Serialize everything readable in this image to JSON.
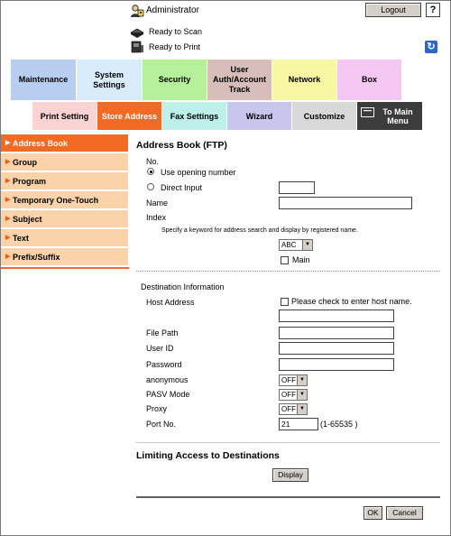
{
  "header": {
    "user": "Administrator",
    "logout_label": "Logout",
    "help_label": "?",
    "status_scan": "Ready to Scan",
    "status_print": "Ready to Print"
  },
  "top_tabs": [
    {
      "label": "Maintenance",
      "color": "#b8cef0"
    },
    {
      "label": "System Settings",
      "color": "#d9ecfb"
    },
    {
      "label": "Security",
      "color": "#b6f09a"
    },
    {
      "label": "User Auth/Account Track",
      "color": "#d7bebb"
    },
    {
      "label": "Network",
      "color": "#f8f7a4"
    },
    {
      "label": "Box",
      "color": "#f5c8f3"
    }
  ],
  "sub_tabs": [
    {
      "label": "Print Setting",
      "color": "#fbd3d3"
    },
    {
      "label": "Store Address",
      "color": "#f26a24",
      "active": true
    },
    {
      "label": "Fax Settings",
      "color": "#bdf0ea"
    },
    {
      "label": "Wizard",
      "color": "#c9c6ee"
    },
    {
      "label": "Customize",
      "color": "#d8d8d8"
    },
    {
      "label": "To Main Menu",
      "color": "#3c3c3c"
    }
  ],
  "sidebar": {
    "items": [
      {
        "label": "Address Book",
        "active": true
      },
      {
        "label": "Group"
      },
      {
        "label": "Program"
      },
      {
        "label": "Temporary One-Touch"
      },
      {
        "label": "Subject"
      },
      {
        "label": "Text"
      },
      {
        "label": "Prefix/Suffix"
      }
    ]
  },
  "form": {
    "title": "Address Book (FTP)",
    "no_label": "No.",
    "opt_opening": "Use opening number",
    "opt_direct": "Direct Input",
    "direct_value": "",
    "name_label": "Name",
    "name_value": "",
    "index_label": "Index",
    "index_hint": "Specify a keyword for address search and display by registered name.",
    "index_value": "ABC",
    "main_label": "Main",
    "dest_title": "Destination Information",
    "host_label": "Host Address",
    "host_check_label": "Please check to enter host name.",
    "host_value": "",
    "filepath_label": "File Path",
    "filepath_value": "",
    "userid_label": "User ID",
    "userid_value": "",
    "password_label": "Password",
    "password_value": "",
    "anon_label": "anonymous",
    "anon_value": "OFF",
    "pasv_label": "PASV Mode",
    "pasv_value": "OFF",
    "proxy_label": "Proxy",
    "proxy_value": "OFF",
    "port_label": "Port No.",
    "port_value": "21",
    "port_range": "(1-65535 )",
    "limit_title": "Limiting Access to Destinations",
    "display_label": "Display",
    "ok_label": "OK",
    "cancel_label": "Cancel"
  },
  "colors": {
    "accent": "#f26a24",
    "sidebar_bg": "#fbd3ab"
  }
}
